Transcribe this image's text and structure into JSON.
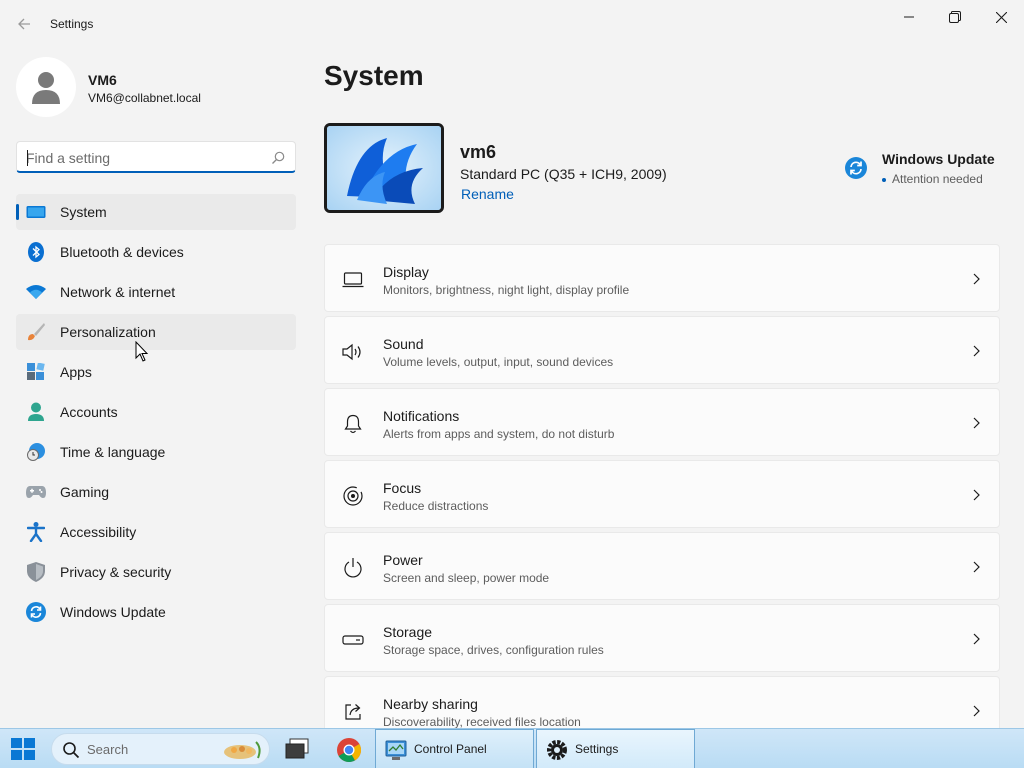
{
  "window": {
    "title": "Settings"
  },
  "profile": {
    "name": "VM6",
    "email": "VM6@collabnet.local"
  },
  "search": {
    "placeholder": "Find a setting",
    "value": ""
  },
  "nav": {
    "items": [
      {
        "label": "System",
        "icon": "system-icon",
        "active": true
      },
      {
        "label": "Bluetooth & devices",
        "icon": "bluetooth-icon"
      },
      {
        "label": "Network & internet",
        "icon": "wifi-icon"
      },
      {
        "label": "Personalization",
        "icon": "brush-icon",
        "hover": true
      },
      {
        "label": "Apps",
        "icon": "apps-icon"
      },
      {
        "label": "Accounts",
        "icon": "account-icon"
      },
      {
        "label": "Time & language",
        "icon": "globe-clock-icon"
      },
      {
        "label": "Gaming",
        "icon": "gamepad-icon"
      },
      {
        "label": "Accessibility",
        "icon": "accessibility-icon"
      },
      {
        "label": "Privacy & security",
        "icon": "shield-icon"
      },
      {
        "label": "Windows Update",
        "icon": "update-icon"
      }
    ]
  },
  "main": {
    "title": "System",
    "device": {
      "name": "vm6",
      "model": "Standard PC (Q35 + ICH9, 2009)",
      "rename_label": "Rename"
    },
    "windows_update": {
      "title": "Windows Update",
      "status": "Attention needed"
    },
    "cards": [
      {
        "title": "Display",
        "subtitle": "Monitors, brightness, night light, display profile",
        "icon": "display-icon"
      },
      {
        "title": "Sound",
        "subtitle": "Volume levels, output, input, sound devices",
        "icon": "speaker-icon"
      },
      {
        "title": "Notifications",
        "subtitle": "Alerts from apps and system, do not disturb",
        "icon": "bell-icon"
      },
      {
        "title": "Focus",
        "subtitle": "Reduce distractions",
        "icon": "focus-icon"
      },
      {
        "title": "Power",
        "subtitle": "Screen and sleep, power mode",
        "icon": "power-icon"
      },
      {
        "title": "Storage",
        "subtitle": "Storage space, drives, configuration rules",
        "icon": "storage-icon"
      },
      {
        "title": "Nearby sharing",
        "subtitle": "Discoverability, received files location",
        "icon": "share-icon"
      }
    ]
  },
  "taskbar": {
    "search_placeholder": "Search",
    "apps": [
      {
        "label": "Control Panel",
        "icon": "control-panel-icon"
      },
      {
        "label": "Settings",
        "icon": "settings-gear-icon",
        "active": true
      }
    ]
  },
  "colors": {
    "accent": "#005fb8",
    "background": "#f3f3f3",
    "card": "#fbfbfb"
  }
}
